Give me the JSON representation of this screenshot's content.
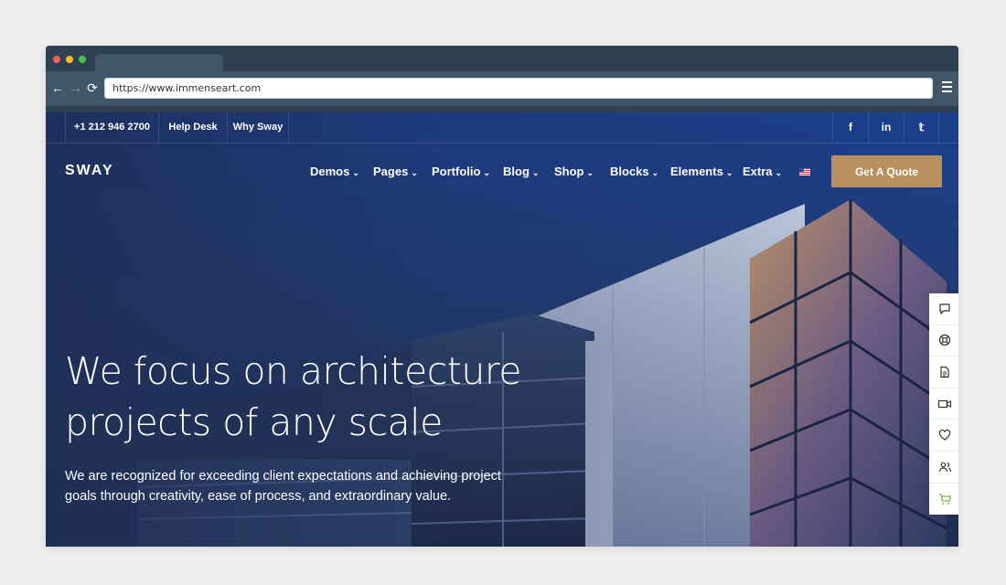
{
  "browser": {
    "url": "https://www.immenseart.com",
    "dots": [
      "#ee5f59",
      "#f5be2e",
      "#3fc64b"
    ]
  },
  "topbar": {
    "phone": "+1 212 946 2700",
    "help": "Help Desk",
    "why": "Why Sway",
    "social": [
      "facebook-icon",
      "linkedin-icon",
      "twitter-icon"
    ],
    "social_labels": [
      "f",
      "in",
      "𝕥"
    ]
  },
  "logo": "SWAY",
  "nav": [
    "Demos",
    "Pages",
    "Portfolio",
    "Blog",
    "Shop",
    "Blocks",
    "Elements",
    "Extra"
  ],
  "quote_button": "Get A Quote",
  "hero": {
    "title_line1": "We focus on architecture",
    "title_line2": "projects of any scale",
    "subtitle_line1": "We are recognized for exceeding client expectations and achieving project",
    "subtitle_line2": "goals through creativity, ease of process, and extraordinary value."
  },
  "colors": {
    "accent": "#b8905d",
    "cart": "#7cb342"
  },
  "sidetools": [
    "chat-icon",
    "lifebuoy-icon",
    "document-icon",
    "video-icon",
    "heart-icon",
    "users-icon",
    "cart-icon"
  ]
}
